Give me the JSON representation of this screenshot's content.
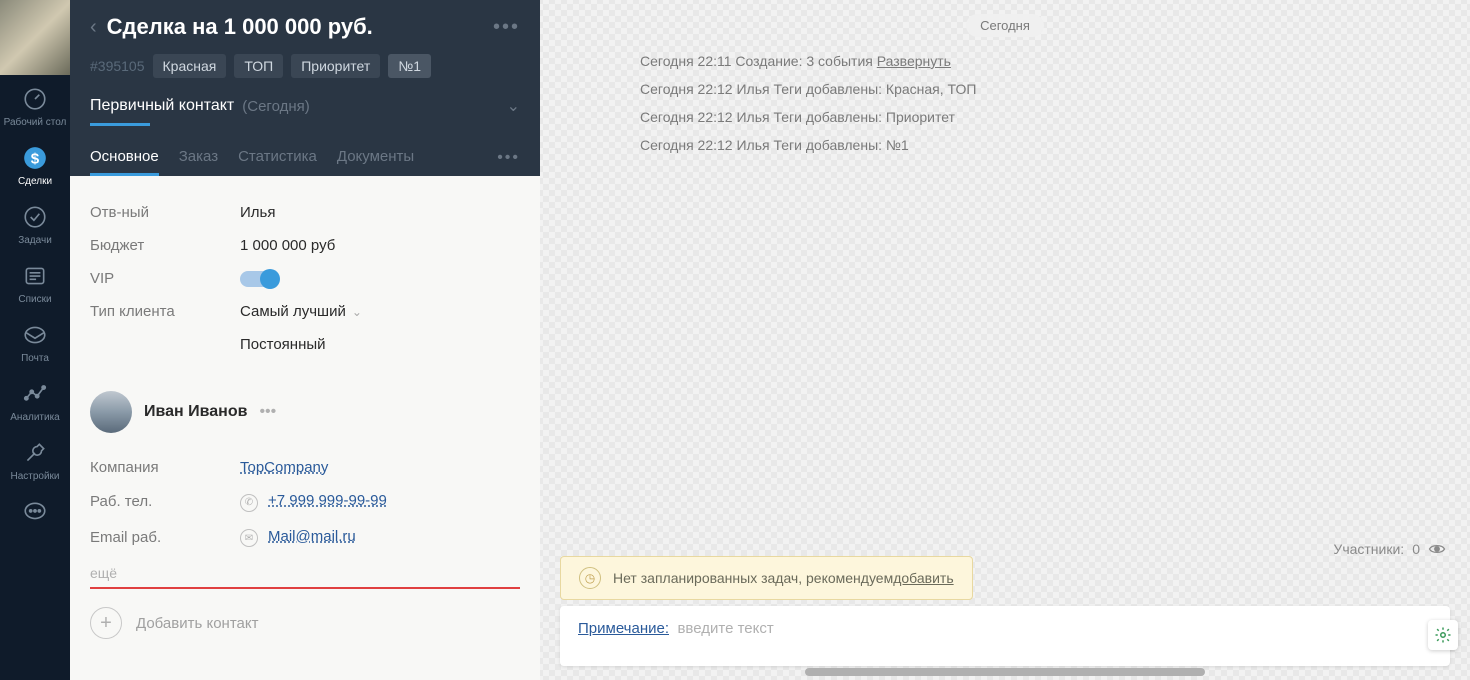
{
  "nav": {
    "items": [
      {
        "label": "Рабочий\nстол",
        "icon": "gauge-icon"
      },
      {
        "label": "Сделки",
        "icon": "deals-icon",
        "active": true
      },
      {
        "label": "Задачи",
        "icon": "check-icon"
      },
      {
        "label": "Списки",
        "icon": "list-icon"
      },
      {
        "label": "Почта",
        "icon": "mail-icon"
      },
      {
        "label": "Аналитика",
        "icon": "analytics-icon"
      },
      {
        "label": "Настройки",
        "icon": "wrench-icon"
      },
      {
        "label": "",
        "icon": "chat-icon"
      }
    ]
  },
  "deal": {
    "title": "Сделка на 1 000 000 руб.",
    "id": "#395105",
    "tags": [
      "Красная",
      "ТОП",
      "Приоритет",
      "№1"
    ],
    "stage": {
      "name": "Первичный контакт",
      "note": "(Сегодня)"
    },
    "tabs": [
      "Основное",
      "Заказ",
      "Статистика",
      "Документы"
    ],
    "fields": {
      "responsible": {
        "label": "Отв-ный",
        "value": "Илья"
      },
      "budget": {
        "label": "Бюджет",
        "value": "1 000 000 руб"
      },
      "vip": {
        "label": "VIP",
        "on": true
      },
      "client_type": {
        "label": "Тип клиента",
        "value": "Самый лучший",
        "sub": "Постоянный"
      }
    },
    "contact": {
      "name": "Иван Иванов",
      "company": {
        "label": "Компания",
        "value": "TopCompany"
      },
      "phone": {
        "label": "Раб. тел.",
        "value": "+7 999 999-99-99"
      },
      "email": {
        "label": "Email раб.",
        "value": "Mail@mail.ru"
      },
      "more": "ещё"
    },
    "add_contact": "Добавить контакт"
  },
  "feed": {
    "date_pill": "Сегодня",
    "events": [
      {
        "text": "Сегодня 22:11 Создание: 3 события ",
        "link": "Развернуть"
      },
      {
        "text": "Сегодня 22:12 Илья  Теги добавлены: Красная, ТОП"
      },
      {
        "text": "Сегодня 22:12 Илья  Теги добавлены: Приоритет"
      },
      {
        "text": "Сегодня 22:12 Илья  Теги добавлены: №1"
      }
    ],
    "task_banner": {
      "text": "Нет запланированных задач, рекомендуем ",
      "link": "добавить"
    },
    "participants": {
      "label": "Участники: ",
      "count": "0"
    },
    "note": {
      "label": "Примечание:",
      "hint": "введите текст"
    }
  }
}
